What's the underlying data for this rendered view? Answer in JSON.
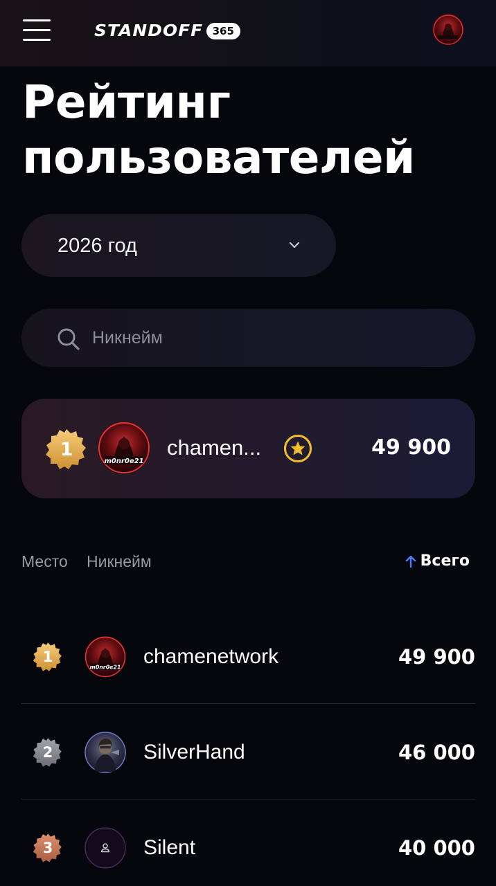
{
  "header": {
    "logo_text": "STANDOFF",
    "logo_badge": "365",
    "menu_icon": "hamburger-menu-icon",
    "avatar_icon": "user-avatar"
  },
  "page": {
    "title_line1": "Рейтинг",
    "title_line2": "пользователей"
  },
  "year_select": {
    "value": "2026 год",
    "icon": "chevron-down-icon"
  },
  "search": {
    "placeholder": "Никнейм",
    "icon": "search-icon"
  },
  "current_user": {
    "place": "1",
    "nickname": "chamen...",
    "score": "49 900",
    "star_icon": "star-icon",
    "avatar_text": "m0nr0e21"
  },
  "table": {
    "col_place": "Место",
    "col_nickname": "Никнейм",
    "col_total": "Всего",
    "sort_icon": "arrow-up-icon",
    "rows": [
      {
        "place": "1",
        "nickname": "chamenetwork",
        "score": "49 900",
        "badge": "gold",
        "avatar_text": "m0nr0e21"
      },
      {
        "place": "2",
        "nickname": "SilverHand",
        "score": "46 000",
        "badge": "silver",
        "avatar_text": ""
      },
      {
        "place": "3",
        "nickname": "Silent",
        "score": "40 000",
        "badge": "bronze",
        "avatar_text": ""
      }
    ]
  },
  "colors": {
    "gold": "#e2a850",
    "silver": "#8a8a92",
    "bronze": "#c77a5a",
    "accent_blue": "#4f7bff",
    "star_yellow": "#f3bf2a"
  }
}
